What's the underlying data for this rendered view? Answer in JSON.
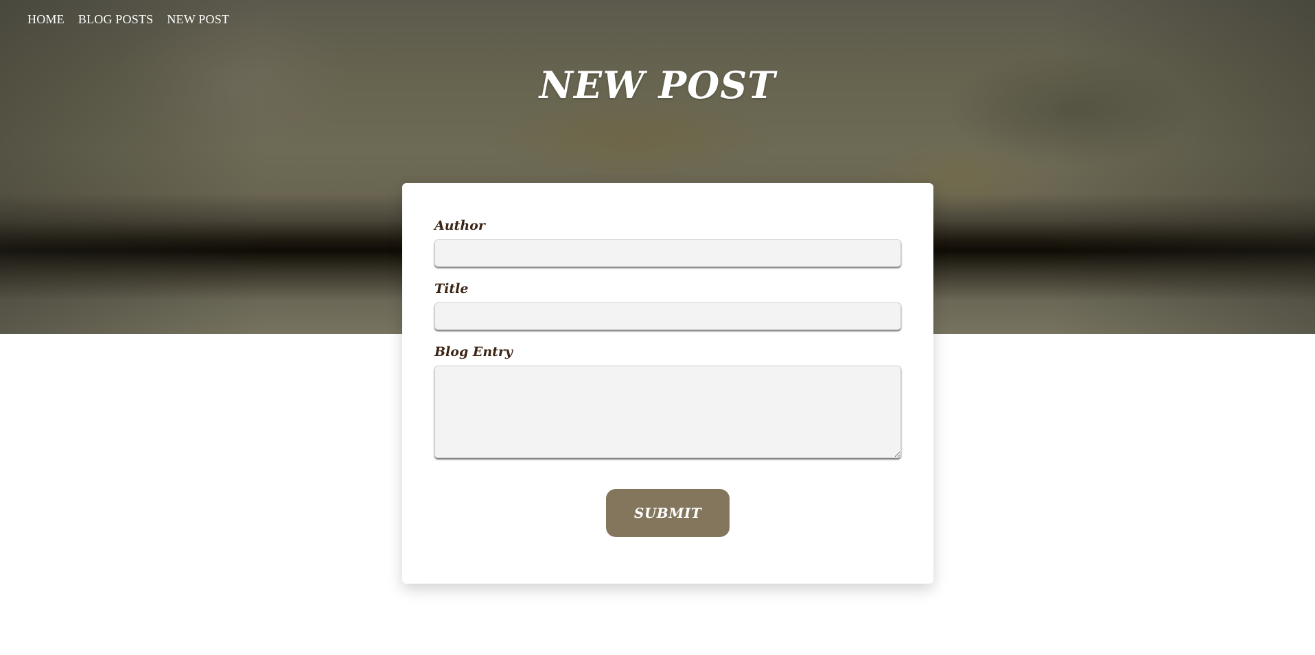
{
  "nav": {
    "items": [
      {
        "label": "HOME"
      },
      {
        "label": "BLOG POSTS"
      },
      {
        "label": "NEW POST"
      }
    ]
  },
  "hero": {
    "title": "NEW POST"
  },
  "form": {
    "author": {
      "label": "Author",
      "value": "",
      "placeholder": ""
    },
    "title": {
      "label": "Title",
      "value": "",
      "placeholder": ""
    },
    "blog_entry": {
      "label": "Blog Entry",
      "value": "",
      "placeholder": ""
    },
    "submit_label": "SUBMIT"
  },
  "colors": {
    "button": "#83765d",
    "label": "#3b2414",
    "input_bg": "#f3f3f3"
  }
}
